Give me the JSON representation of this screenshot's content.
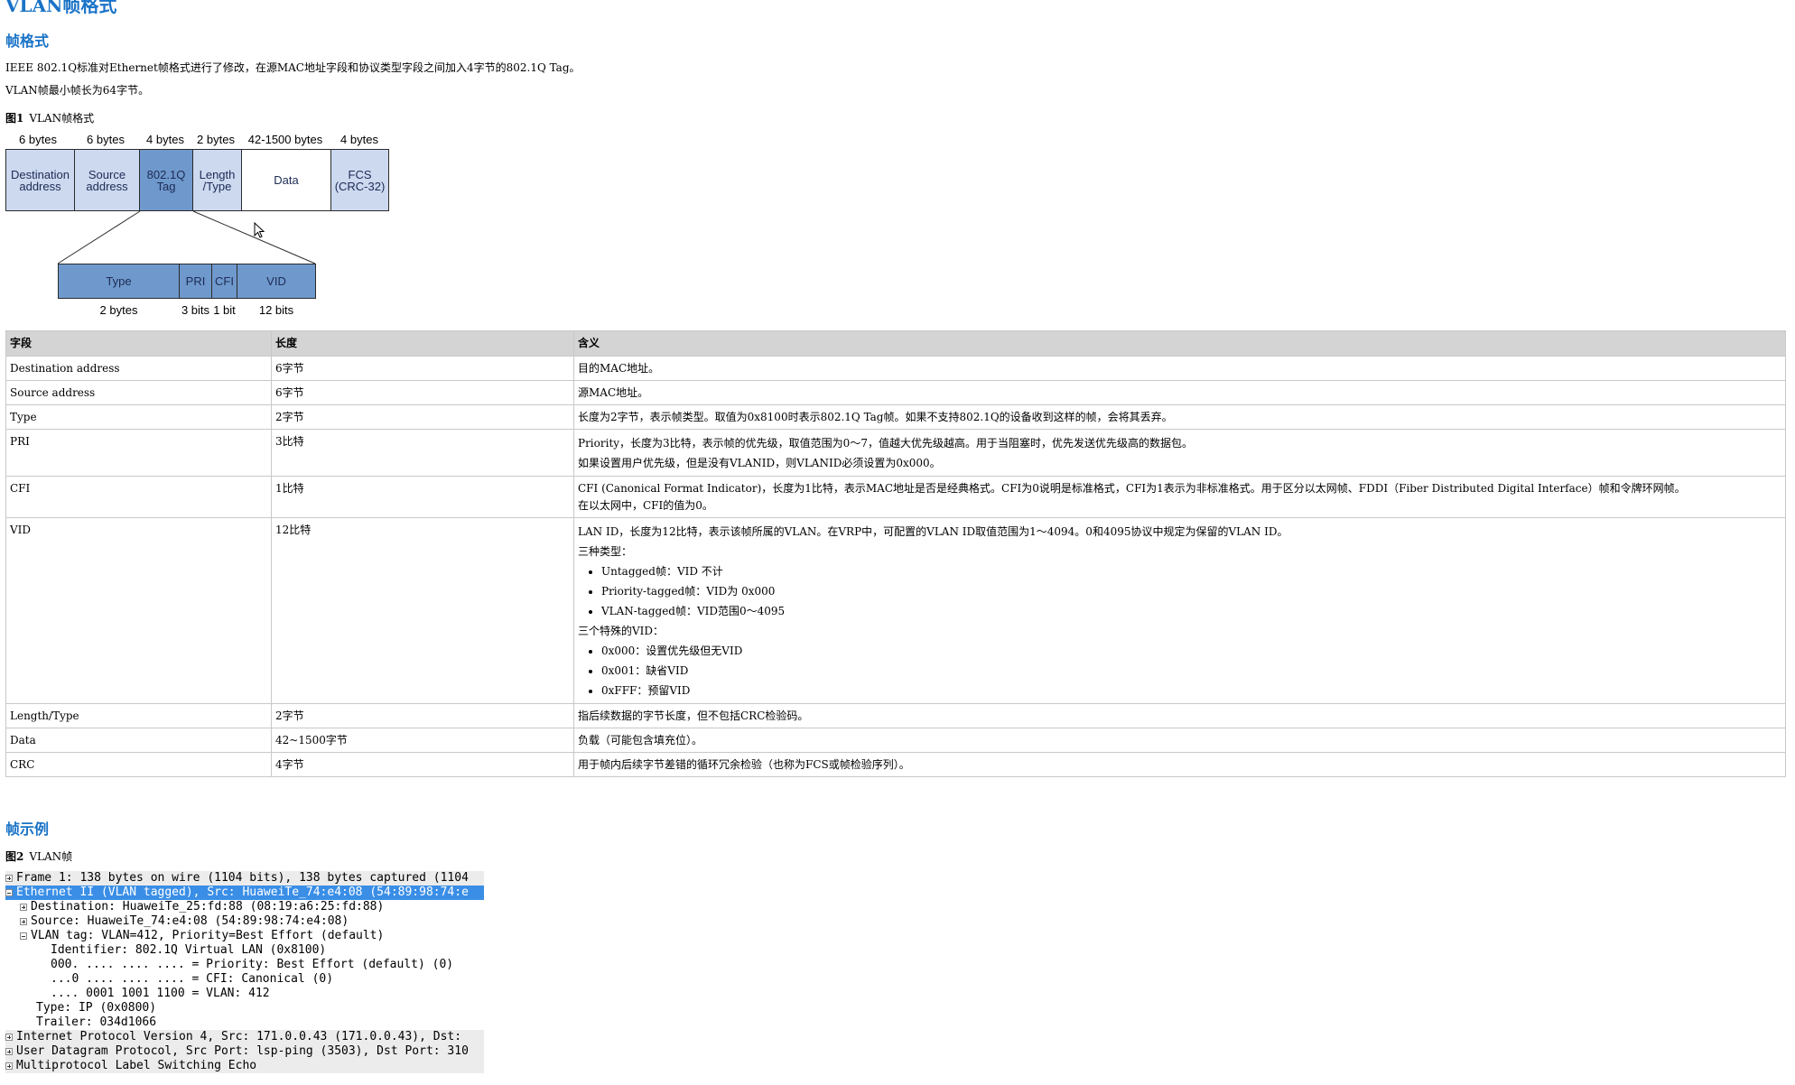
{
  "title": "VLAN帧格式",
  "section_format": "帧格式",
  "para1": "IEEE 802.1Q标准对Ethernet帧格式进行了修改，在源MAC地址字段和协议类型字段之间加入4字节的802.1Q Tag。",
  "para2": "VLAN帧最小帧长为64字节。",
  "fig1": {
    "num": "图1",
    "caption": "VLAN帧格式"
  },
  "diagram": {
    "top_sizes": [
      "6 bytes",
      "6 bytes",
      "4 bytes",
      "2 bytes",
      "42-1500 bytes",
      "4 bytes"
    ],
    "fields": {
      "dst_1": "Destination",
      "dst_2": "address",
      "src_1": "Source",
      "src_2": "address",
      "tag_1": "802.1Q",
      "tag_2": "Tag",
      "len_1": "Length",
      "len_2": "/Type",
      "data": "Data",
      "fcs_1": "FCS",
      "fcs_2": "(CRC-32)"
    },
    "tag_fields": [
      "Type",
      "PRI",
      "CFI",
      "VID"
    ],
    "bottom_sizes": [
      "2 bytes",
      "3 bits",
      "1 bit",
      "12 bits"
    ]
  },
  "table": {
    "headers": [
      "字段",
      "长度",
      "含义"
    ],
    "rows": [
      {
        "field": "Destination address",
        "len": "6字节",
        "desc": [
          "目的MAC地址。"
        ]
      },
      {
        "field": "Source address",
        "len": "6字节",
        "desc": [
          "源MAC地址。"
        ]
      },
      {
        "field": "Type",
        "len": "2字节",
        "desc": [
          "长度为2字节，表示帧类型。取值为0x8100时表示802.1Q Tag帧。如果不支持802.1Q的设备收到这样的帧，会将其丢弃。"
        ]
      },
      {
        "field": "PRI",
        "len": "3比特",
        "desc": [
          "Priority，长度为3比特，表示帧的优先级，取值范围为0～7，值越大优先级越高。用于当阻塞时，优先发送优先级高的数据包。",
          "如果设置用户优先级，但是没有VLANID，则VLANID必须设置为0x000。"
        ]
      },
      {
        "field": "CFI",
        "len": "1比特",
        "desc": [
          "CFI (Canonical Format Indicator)，长度为1比特，表示MAC地址是否是经典格式。CFI为0说明是标准格式，CFI为1表示为非标准格式。用于区分以太网帧、FDDI（Fiber Distributed Digital Interface）帧和令牌环网帧。",
          "在以太网中，CFI的值为0。"
        ]
      },
      {
        "field": "VID",
        "len": "12比特",
        "desc_intro": "LAN ID，长度为12比特，表示该帧所属的VLAN。在VRP中，可配置的VLAN ID取值范围为1～4094。0和4095协议中规定为保留的VLAN ID。",
        "types_label": "三种类型：",
        "types": [
          "Untagged帧：VID 不计",
          "Priority-tagged帧：VID为 0x000",
          "VLAN-tagged帧：VID范围0～4095"
        ],
        "special_label": "三个特殊的VID：",
        "special": [
          "0x000：设置优先级但无VID",
          "0x001：缺省VID",
          "0xFFF：预留VID"
        ]
      },
      {
        "field": "Length/Type",
        "len": "2字节",
        "desc": [
          "指后续数据的字节长度，但不包括CRC检验码。"
        ]
      },
      {
        "field": "Data",
        "len": "42~1500字节",
        "desc": [
          "负载（可能包含填充位）。"
        ]
      },
      {
        "field": "CRC",
        "len": "4字节",
        "desc": [
          "用于帧内后续字节差错的循环冗余检验（也称为FCS或帧检验序列）。"
        ]
      }
    ]
  },
  "section_example": "帧示例",
  "fig2": {
    "num": "图2",
    "caption": "VLAN帧"
  },
  "packet_tree": [
    "Frame 1: 138 bytes on wire (1104 bits), 138 bytes captured (1104",
    "Ethernet II (VLAN tagged), Src: HuaweiTe_74:e4:08 (54:89:98:74:e",
    "Destination: HuaweiTe_25:fd:88 (08:19:a6:25:fd:88)",
    "Source: HuaweiTe_74:e4:08 (54:89:98:74:e4:08)",
    "VLAN tag: VLAN=412, Priority=Best Effort (default)",
    "Identifier: 802.1Q Virtual LAN (0x8100)",
    "000. .... .... .... = Priority: Best Effort (default) (0)",
    "...0 .... .... .... = CFI: Canonical (0)",
    ".... 0001 1001 1100 = VLAN: 412",
    "Type: IP (0x0800)",
    "Trailer: 034d1066",
    "Internet Protocol Version 4, Src: 171.0.0.43 (171.0.0.43), Dst: ",
    "User Datagram Protocol, Src Port: lsp-ping (3503), Dst Port: 310",
    "Multiprotocol Label Switching Echo"
  ]
}
